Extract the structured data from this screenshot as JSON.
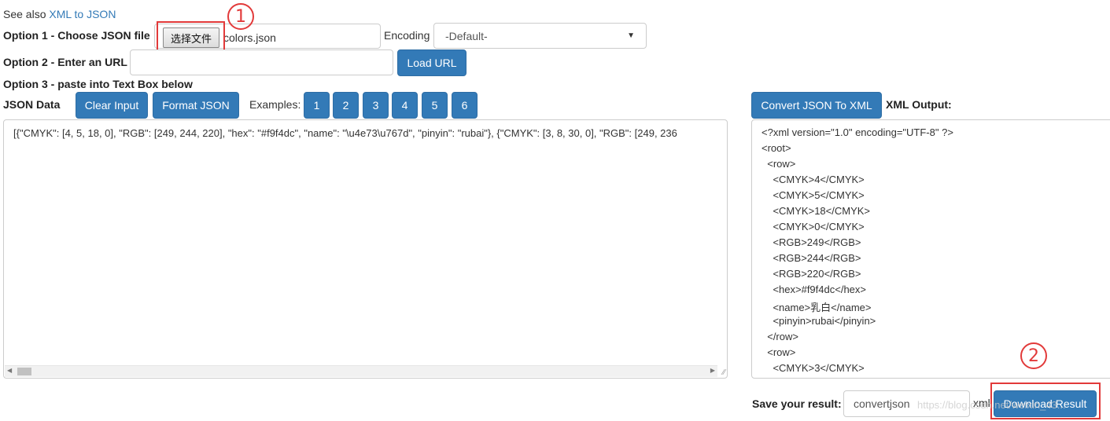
{
  "top": {
    "see_also_prefix": "See also",
    "see_also_link": "XML to JSON"
  },
  "option1": {
    "label": "Option 1 - Choose JSON file",
    "file_button": "选择文件",
    "file_name": "colors.json",
    "encoding_label": "Encoding",
    "encoding_value": "-Default-"
  },
  "option2": {
    "label": "Option 2 - Enter an URL",
    "url_value": "",
    "load_button": "Load URL"
  },
  "option3": {
    "label": "Option 3 - paste into Text Box below"
  },
  "json_section": {
    "label": "JSON Data",
    "clear_button": "Clear Input",
    "format_button": "Format JSON",
    "examples_label": "Examples:",
    "examples": [
      "1",
      "2",
      "3",
      "4",
      "5",
      "6"
    ],
    "content": "[{\"CMYK\": [4, 5, 18, 0], \"RGB\": [249, 244, 220], \"hex\": \"#f9f4dc\", \"name\": \"\\u4e73\\u767d\", \"pinyin\": \"rubai\"}, {\"CMYK\": [3, 8, 30, 0], \"RGB\": [249, 236"
  },
  "xml_section": {
    "convert_button": "Convert JSON To XML",
    "output_label": "XML Output:",
    "lines": [
      "<?xml version=\"1.0\" encoding=\"UTF-8\" ?>",
      "<root>",
      "  <row>",
      "    <CMYK>4</CMYK>",
      "    <CMYK>5</CMYK>",
      "    <CMYK>18</CMYK>",
      "    <CMYK>0</CMYK>",
      "    <RGB>249</RGB>",
      "    <RGB>244</RGB>",
      "    <RGB>220</RGB>",
      "    <hex>#f9f4dc</hex>",
      "    <name>乳白</name>",
      "    <pinyin>rubai</pinyin>",
      "  </row>",
      "  <row>",
      "    <CMYK>3</CMYK>"
    ]
  },
  "save": {
    "label": "Save your result:",
    "filename": "convertjson",
    "extension": "xml",
    "download_button": "Download Result"
  },
  "annotations": {
    "marker1": "1",
    "marker2": "2",
    "watermark": "https://blog.csdn.net/weixin_43..."
  },
  "colors": {
    "primary": "#337ab7",
    "annotation_red": "#e23a3a"
  }
}
